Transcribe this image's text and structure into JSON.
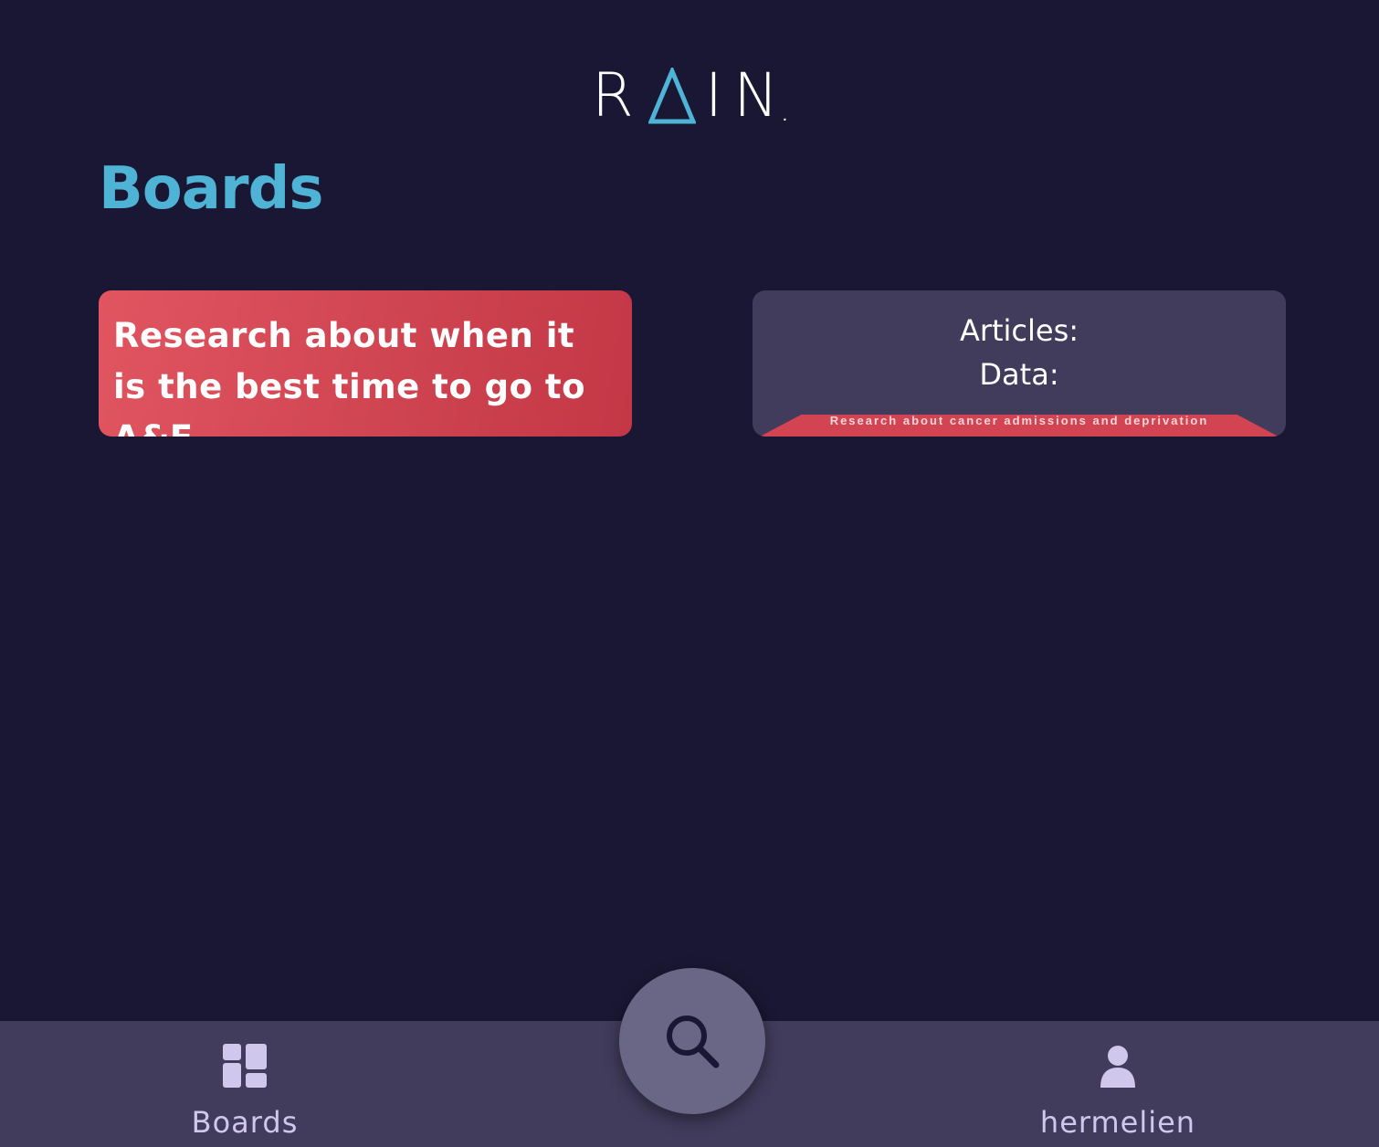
{
  "header": {
    "logo_text_left": "R",
    "logo_text_right": "IN",
    "logo_dot": ".",
    "brand_accent": "#4fb3d6"
  },
  "page": {
    "title": "Boards"
  },
  "boards": [
    {
      "title": "Research about when it is the best time to go to A&E",
      "color": "#d64452"
    },
    {
      "articles_label": "Articles:",
      "data_label": "Data:",
      "flip_text": "Research about cancer admissions and deprivation",
      "color": "#423c5c"
    }
  ],
  "bottom_nav": {
    "boards_label": "Boards",
    "profile_label": "hermelien",
    "search_icon": "search-icon",
    "boards_icon": "dashboard-icon",
    "profile_icon": "user-icon"
  }
}
